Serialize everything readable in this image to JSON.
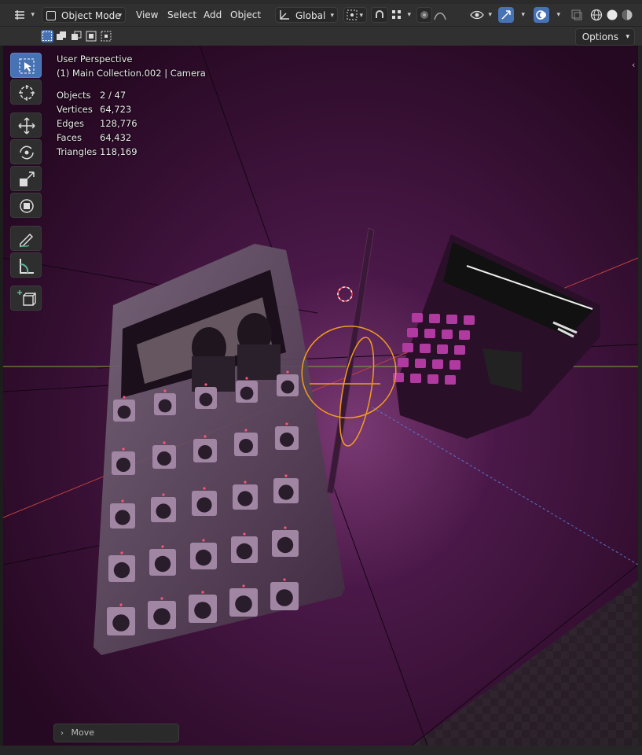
{
  "header": {
    "editor_type_icon": "3d-viewport-icon",
    "mode_label": "Object Mode",
    "menus": [
      "View",
      "Select",
      "Add",
      "Object"
    ],
    "orientation_label": "Global",
    "icons": [
      "pivot-icon",
      "snap-icon",
      "snap-increment-icon",
      "proportional-edit-icon",
      "falloff-icon",
      "visibility-icon",
      "gizmo-icon",
      "overlay-icon",
      "xray-icon",
      "shading-wireframe-icon",
      "shading-solid-icon",
      "shading-material-icon"
    ]
  },
  "subheader": {
    "select_modes": [
      "select-new-icon",
      "select-extend-icon",
      "select-subtract-icon",
      "select-invert-icon",
      "select-intersect-icon"
    ],
    "options_label": "Options"
  },
  "toolbar": {
    "tools": [
      "select-box-icon",
      "cursor-icon",
      "move-icon",
      "rotate-icon",
      "scale-icon",
      "transform-icon",
      "annotate-icon",
      "measure-icon",
      "add-cube-icon"
    ],
    "active": "select-box-icon"
  },
  "info": {
    "line1": "User Perspective",
    "line2": "(1) Main Collection.002 | Camera",
    "stats": [
      {
        "label": "Objects",
        "value": "2 / 47"
      },
      {
        "label": "Vertices",
        "value": "64,723"
      },
      {
        "label": "Edges",
        "value": "128,776"
      },
      {
        "label": "Faces",
        "value": "64,432"
      },
      {
        "label": "Triangles",
        "value": "118,169"
      }
    ]
  },
  "redo_panel": {
    "label": "Move"
  },
  "colors": {
    "accent": "#4772b3",
    "viewport_bg": "#2a0a26",
    "x_axis": "#c0413f",
    "y_axis": "#7bab3c",
    "selection": "#f29b1f"
  }
}
